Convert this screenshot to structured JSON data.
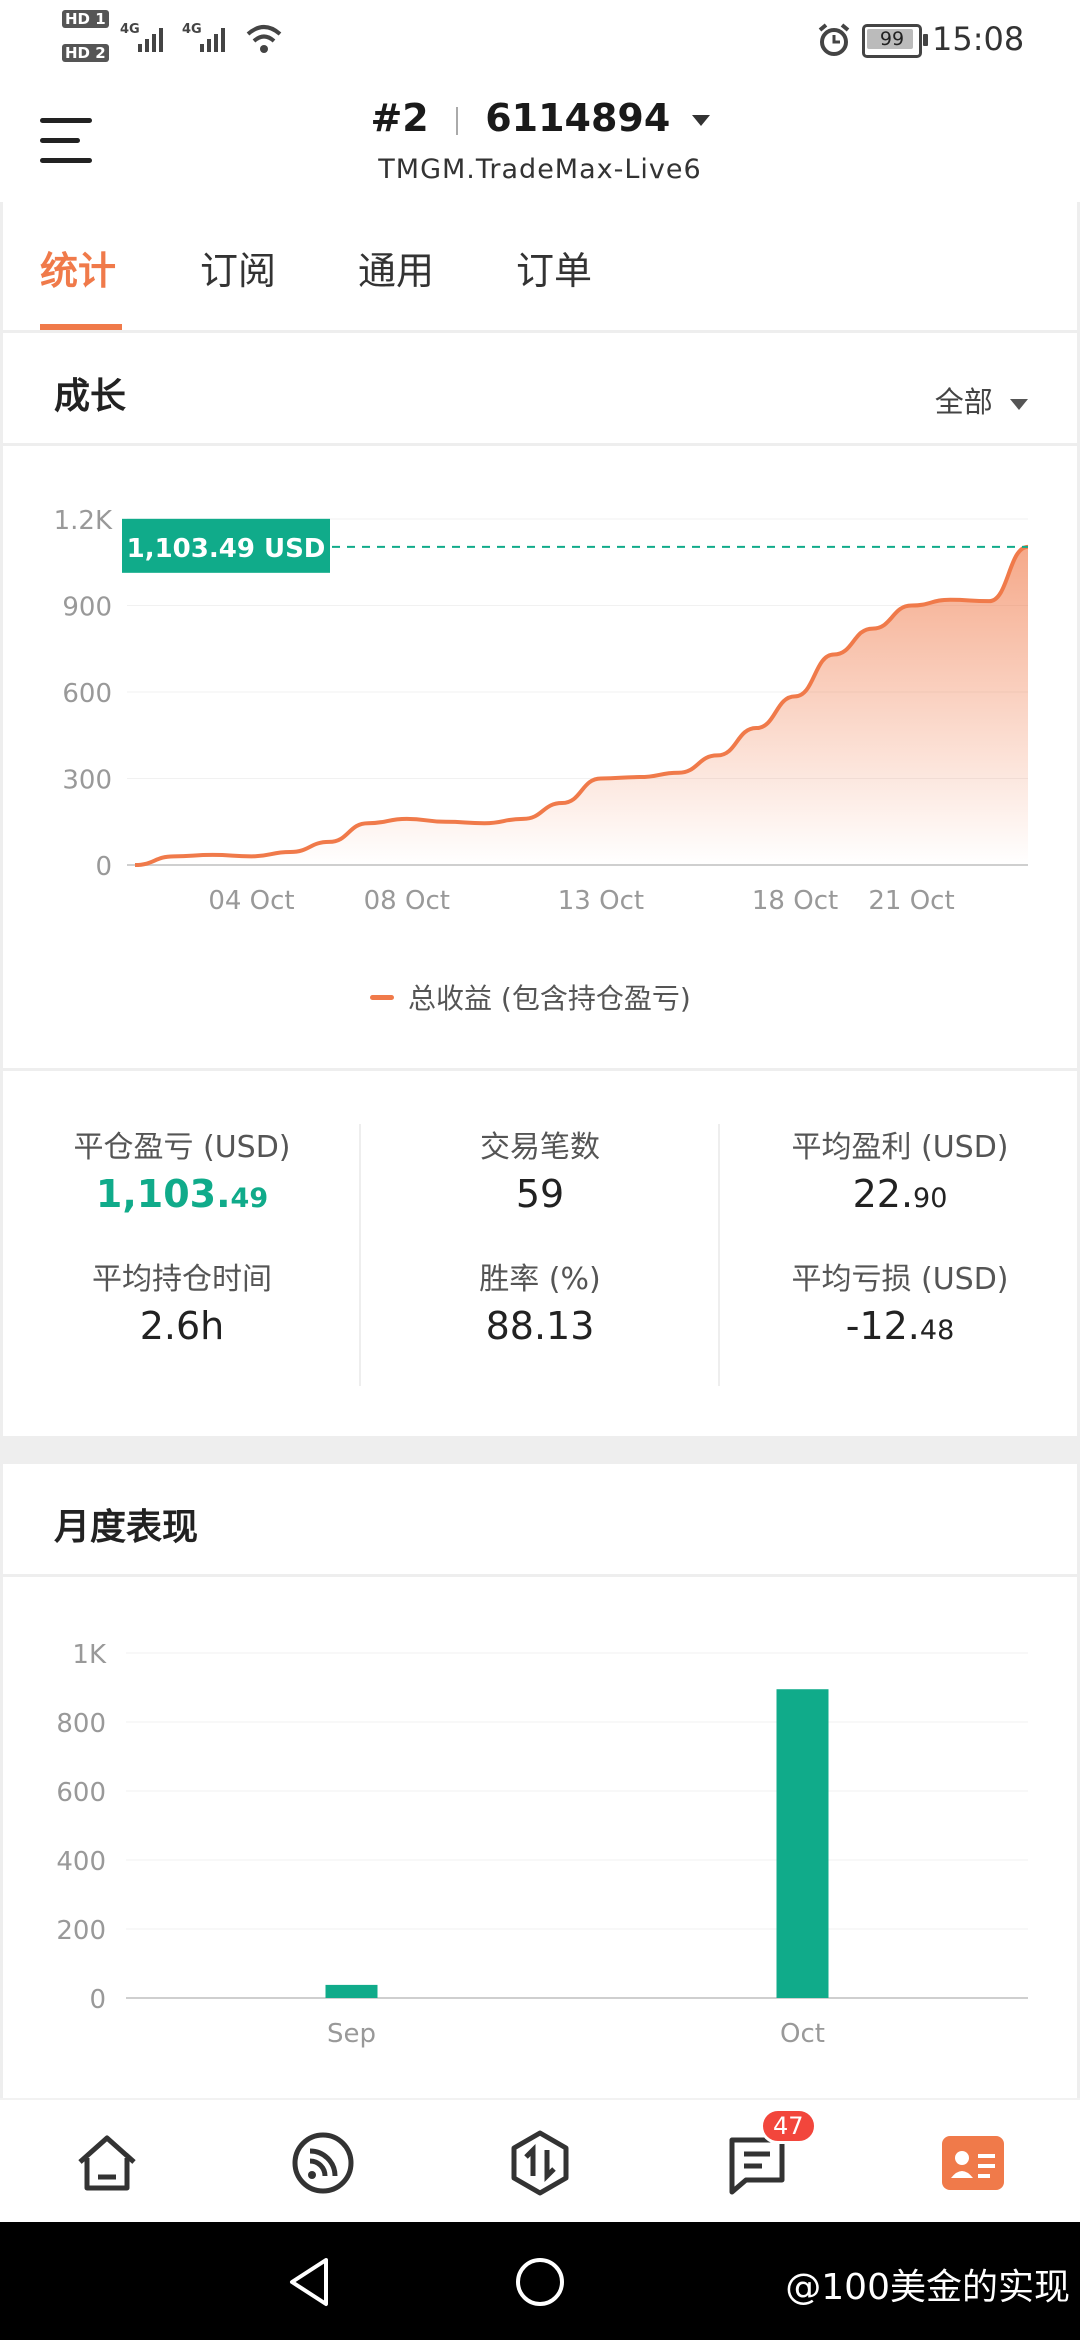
{
  "status_bar": {
    "hd1": "HD 1",
    "hd2": "HD 2",
    "net1": "4G",
    "net2": "4G",
    "battery": "99",
    "time": "15:08",
    "icons": [
      "signal-icon",
      "wifi-icon",
      "alarm-icon",
      "battery-icon"
    ]
  },
  "header": {
    "account_num": "#2",
    "account_id": "6114894",
    "server": "TMGM.TradeMax-Live6"
  },
  "tabs": [
    {
      "label": "统计",
      "active": true
    },
    {
      "label": "订阅",
      "active": false
    },
    {
      "label": "通用",
      "active": false
    },
    {
      "label": "订单",
      "active": false
    }
  ],
  "growth": {
    "title": "成长",
    "range": "全部",
    "legend": "总收益 (包含持仓盈亏)",
    "current_label": "1,103.49 USD"
  },
  "stats": {
    "closed_pnl": {
      "label": "平仓盈亏 (USD)",
      "main": "1,103.",
      "dec": "49"
    },
    "trades": {
      "label": "交易笔数",
      "value": "59"
    },
    "avg_profit": {
      "label": "平均盈利 (USD)",
      "main": "22.",
      "dec": "90"
    },
    "avg_hold": {
      "label": "平均持仓时间",
      "value": "2.6h"
    },
    "win_rate": {
      "label": "胜率 (%)",
      "value": "88.13"
    },
    "avg_loss": {
      "label": "平均亏损 (USD)",
      "main": "-12.",
      "dec": "48"
    }
  },
  "monthly": {
    "title": "月度表现"
  },
  "colors": {
    "accent": "#f07a4a",
    "green": "#10ab8a",
    "badge": "#f2463c"
  },
  "bottom_nav": {
    "items": [
      "home-icon",
      "feed-icon",
      "trade-icon",
      "messages-icon",
      "profile-icon"
    ],
    "badge": "47"
  },
  "watermark": "@100美金的实现",
  "chart_data": [
    {
      "type": "area",
      "title": "",
      "series": [
        {
          "name": "总收益 (包含持仓盈亏)",
          "x": [
            "10-01",
            "10-02",
            "10-03",
            "10-04",
            "10-05",
            "10-06",
            "10-07",
            "10-08",
            "10-09",
            "10-10",
            "10-11",
            "10-12",
            "10-13",
            "10-14",
            "10-15",
            "10-16",
            "10-17",
            "10-18",
            "10-19",
            "10-20",
            "10-21",
            "10-22",
            "10-23",
            "10-24"
          ],
          "values": [
            0,
            30,
            35,
            30,
            45,
            80,
            145,
            160,
            150,
            145,
            160,
            215,
            300,
            305,
            320,
            380,
            475,
            585,
            730,
            820,
            900,
            920,
            915,
            1103.49
          ]
        }
      ],
      "xticks": [
        "04 Oct",
        "08 Oct",
        "13 Oct",
        "18 Oct",
        "21 Oct"
      ],
      "yticks": [
        "0",
        "300",
        "600",
        "900",
        "1.2K"
      ],
      "ylim": [
        0,
        1200
      ],
      "reference_line": 1103.49,
      "grid": true,
      "legend": "bottom-center"
    },
    {
      "type": "bar",
      "categories": [
        "Sep",
        "Oct"
      ],
      "values": [
        38,
        895
      ],
      "yticks": [
        "0",
        "200",
        "400",
        "600",
        "800",
        "1K"
      ],
      "ylim": [
        0,
        1000
      ],
      "grid": true
    }
  ]
}
